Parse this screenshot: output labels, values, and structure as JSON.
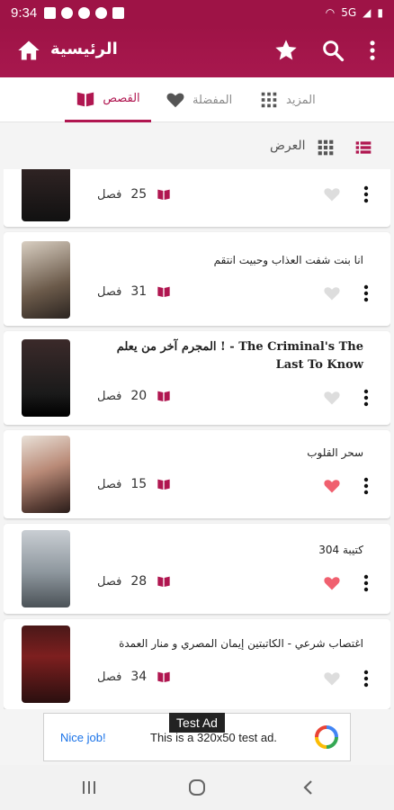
{
  "status": {
    "time": "9:34",
    "network": "5G"
  },
  "appbar": {
    "title": "الرئيسية"
  },
  "tabs": [
    {
      "label": "القصص",
      "active": true
    },
    {
      "label": "المفضلة",
      "active": false
    },
    {
      "label": "المزيد",
      "active": false
    }
  ],
  "view": {
    "label": "العرض"
  },
  "stories": [
    {
      "title": "",
      "chapters_label": "فصل",
      "chapters": "25",
      "favorite": false
    },
    {
      "title": "انا بنت شفت العذاب وحبيت انتقم",
      "chapters_label": "فصل",
      "chapters": "31",
      "favorite": false
    },
    {
      "title": "المجرم آخر من يعلم ! - The Criminal's The Last To Know",
      "chapters_label": "فصل",
      "chapters": "20",
      "favorite": false
    },
    {
      "title": "سحر القلوب",
      "chapters_label": "فصل",
      "chapters": "15",
      "favorite": true
    },
    {
      "title": "كتيبة 304",
      "chapters_label": "فصل",
      "chapters": "28",
      "favorite": true
    },
    {
      "title": "اغتصاب شرعي - الكاتبتين إيمان المصري و منار العمدة",
      "chapters_label": "فصل",
      "chapters": "34",
      "favorite": false
    }
  ],
  "ad": {
    "tag": "Test Ad",
    "nice": "Nice job!",
    "text": "This is a 320x50 test ad."
  },
  "colors": {
    "primary": "#9e1346",
    "accent": "#b01650",
    "heart_active": "#f0606f",
    "heart_inactive": "#dddddd"
  }
}
